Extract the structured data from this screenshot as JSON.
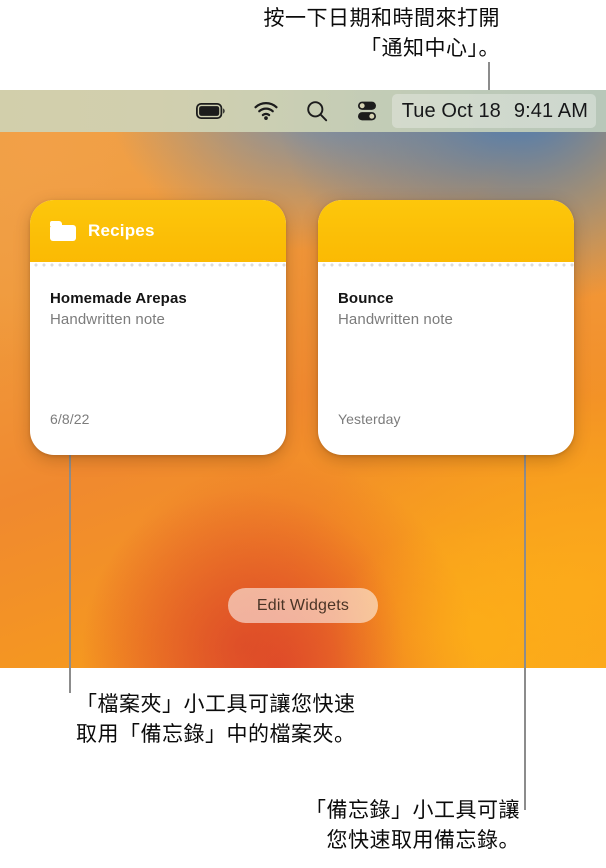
{
  "annotations": {
    "top": "按一下日期和時間來打開\n「通知中心」。",
    "left_bottom": "「檔案夾」小工具可讓您快速\n取用「備忘錄」中的檔案夾。",
    "right_bottom": "「備忘錄」小工具可讓\n您快速取用備忘錄。"
  },
  "menubar": {
    "icons": [
      {
        "name": "battery-icon",
        "label": "Battery"
      },
      {
        "name": "wifi-icon",
        "label": "Wi-Fi"
      },
      {
        "name": "search-icon",
        "label": "Spotlight Search"
      },
      {
        "name": "control-center-icon",
        "label": "Control Center"
      }
    ],
    "date": "Tue Oct 18",
    "time": "9:41 AM"
  },
  "widgets": [
    {
      "id": "recipes",
      "icon": "folder-icon",
      "title": "Recipes",
      "note_title": "Homemade Arepas",
      "note_subtitle": "Handwritten note",
      "date": "6/8/22"
    },
    {
      "id": "bounce",
      "icon": "none",
      "title": "",
      "note_title": "Bounce",
      "note_subtitle": "Handwritten note",
      "date": "Yesterday"
    }
  ],
  "edit_widgets_label": "Edit Widgets",
  "colors": {
    "widget_header_yellow": "#fbbf07",
    "menubar_left": "#d2cfab",
    "menubar_right": "#b8c7b9",
    "leader_line": "#8c8c8c",
    "edit_pill_text": "#4a3426"
  }
}
